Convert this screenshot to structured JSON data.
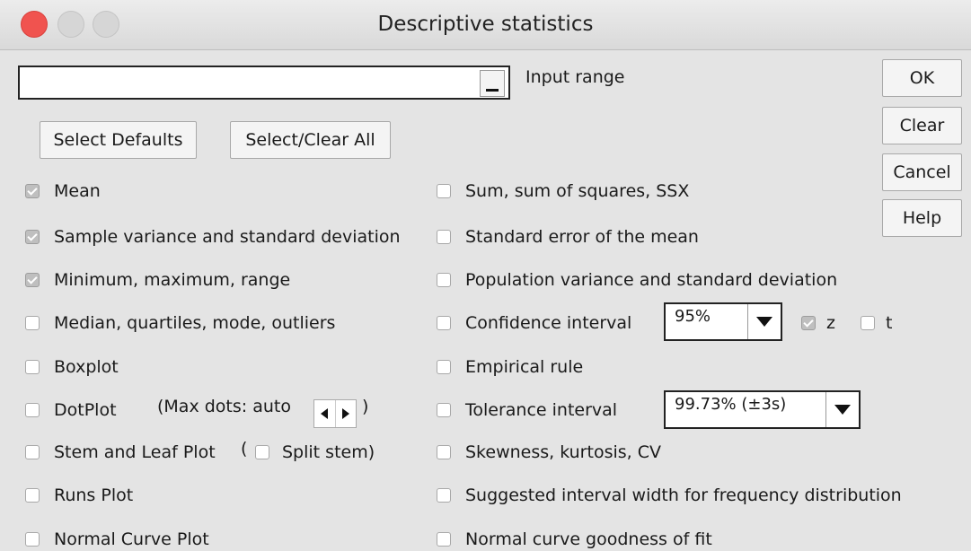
{
  "window": {
    "title": "Descriptive statistics"
  },
  "input_range": {
    "label": "Input range",
    "value": ""
  },
  "buttons": {
    "select_defaults": "Select Defaults",
    "select_clear_all": "Select/Clear All",
    "ok": "OK",
    "clear": "Clear",
    "cancel": "Cancel",
    "help": "Help"
  },
  "options": {
    "mean": {
      "label": "Mean",
      "checked": true
    },
    "sample_variance": {
      "label": "Sample variance and standard deviation",
      "checked": true
    },
    "min_max_range": {
      "label": "Minimum, maximum, range",
      "checked": true
    },
    "median_quartiles": {
      "label": "Median, quartiles, mode, outliers",
      "checked": false
    },
    "boxplot": {
      "label": "Boxplot",
      "checked": false
    },
    "dotplot": {
      "label": "DotPlot",
      "checked": false
    },
    "stem_leaf": {
      "label": "Stem and Leaf Plot",
      "checked": false
    },
    "runs_plot": {
      "label": "Runs Plot",
      "checked": false
    },
    "normal_curve_plot": {
      "label": "Normal Curve Plot",
      "checked": false
    },
    "sum_squares": {
      "label": "Sum, sum of squares, SSX",
      "checked": false
    },
    "std_error": {
      "label": "Standard error of the mean",
      "checked": false
    },
    "population_variance": {
      "label": "Population variance and standard deviation",
      "checked": false
    },
    "confidence_interval": {
      "label": "Confidence interval",
      "checked": false
    },
    "empirical_rule": {
      "label": "Empirical rule",
      "checked": false
    },
    "tolerance_interval": {
      "label": "Tolerance interval",
      "checked": false
    },
    "skewness": {
      "label": "Skewness, kurtosis, CV",
      "checked": false
    },
    "interval_width": {
      "label": "Suggested interval width for frequency distribution",
      "checked": false
    },
    "goodness_of_fit": {
      "label": "Normal curve goodness of fit",
      "checked": false
    }
  },
  "dotplot_max": {
    "text": "(Max dots: auto",
    "close_paren": ")"
  },
  "stem_split": {
    "open_paren": "(",
    "label": "Split stem)",
    "checked": false
  },
  "confidence": {
    "value": "95%",
    "z_label": "z",
    "z_checked": true,
    "t_label": "t",
    "t_checked": false
  },
  "tolerance": {
    "value": "99.73% (±3s)"
  }
}
